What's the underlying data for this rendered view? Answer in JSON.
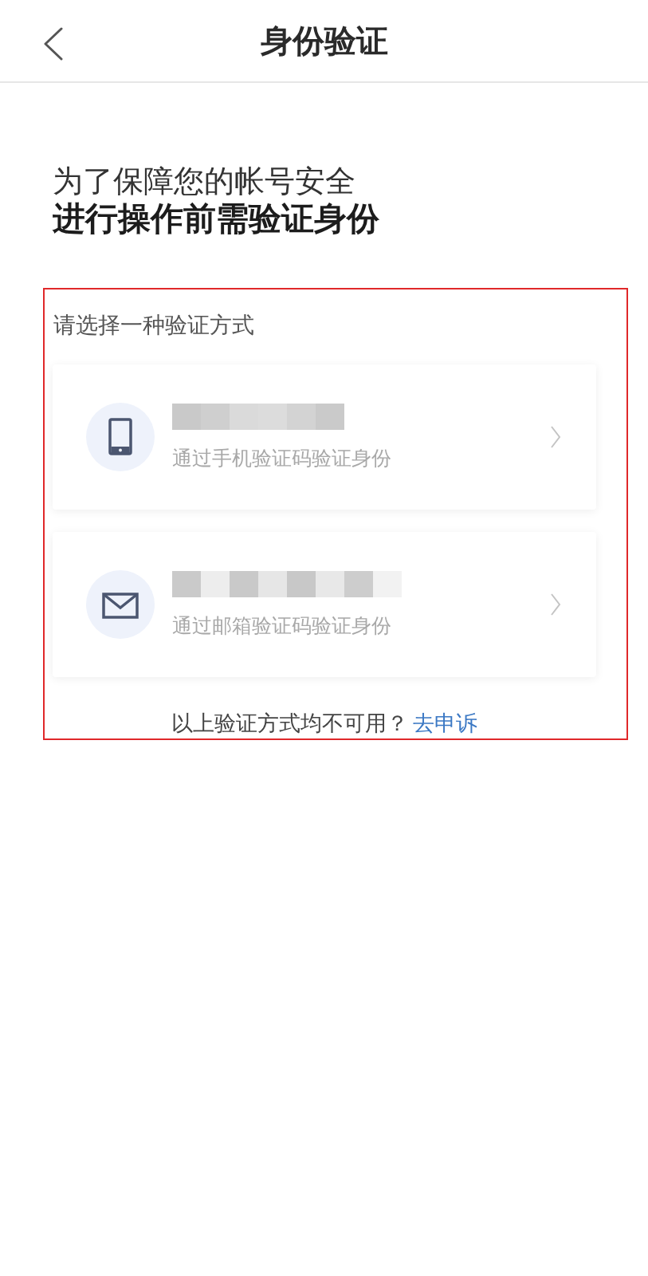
{
  "header": {
    "title": "身份验证"
  },
  "intro": {
    "line_1": "为了保障您的帐号安全",
    "line_2": "进行操作前需验证身份"
  },
  "verification": {
    "highlighted": true,
    "prompt": "请选择一种验证方式",
    "options": [
      {
        "kind": "phone",
        "redacted": true,
        "description": "通过手机验证码验证身份"
      },
      {
        "kind": "email",
        "redacted": true,
        "description": "通过邮箱验证码验证身份"
      }
    ],
    "footer": {
      "text": "以上验证方式均不可用？",
      "link": "去申诉"
    }
  }
}
